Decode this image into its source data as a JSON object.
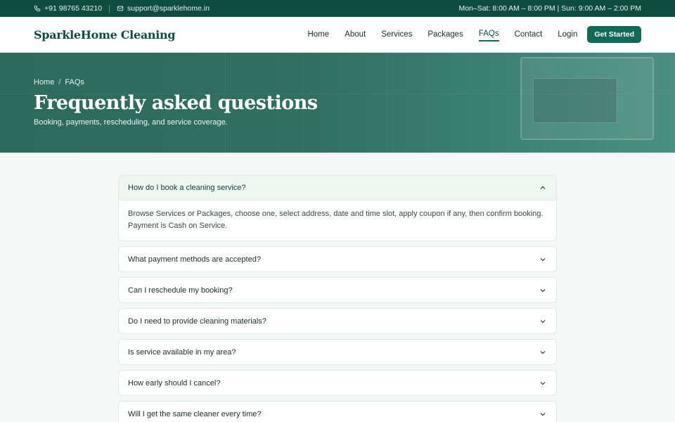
{
  "topbar": {
    "phone": "+91 98765 43210",
    "email": "support@sparklehome.in",
    "hours": "Mon–Sat: 8:00 AM – 8:00 PM | Sun: 9:00 AM – 2:00 PM"
  },
  "nav": {
    "brand": "SparkleHome Cleaning",
    "links": [
      "Home",
      "About",
      "Services",
      "Packages",
      "FAQs",
      "Contact",
      "Login"
    ],
    "active": "FAQs",
    "cta": "Get Started"
  },
  "hero": {
    "breadcrumb": [
      "Home",
      "FAQs"
    ],
    "title": "Frequently asked questions",
    "subtitle": "Booking, payments, rescheduling, and service coverage."
  },
  "faqs": [
    {
      "question": "How do I book a cleaning service?",
      "answer": "Browse Services or Packages, choose one, select address, date and time slot, apply coupon if any, then confirm booking. Payment is Cash on Service.",
      "open": true
    },
    {
      "question": "What payment methods are accepted?",
      "open": false
    },
    {
      "question": "Can I reschedule my booking?",
      "open": false
    },
    {
      "question": "Do I need to provide cleaning materials?",
      "open": false
    },
    {
      "question": "Is service available in my area?",
      "open": false
    },
    {
      "question": "How early should I cancel?",
      "open": false
    },
    {
      "question": "Will I get the same cleaner every time?",
      "open": false
    }
  ]
}
